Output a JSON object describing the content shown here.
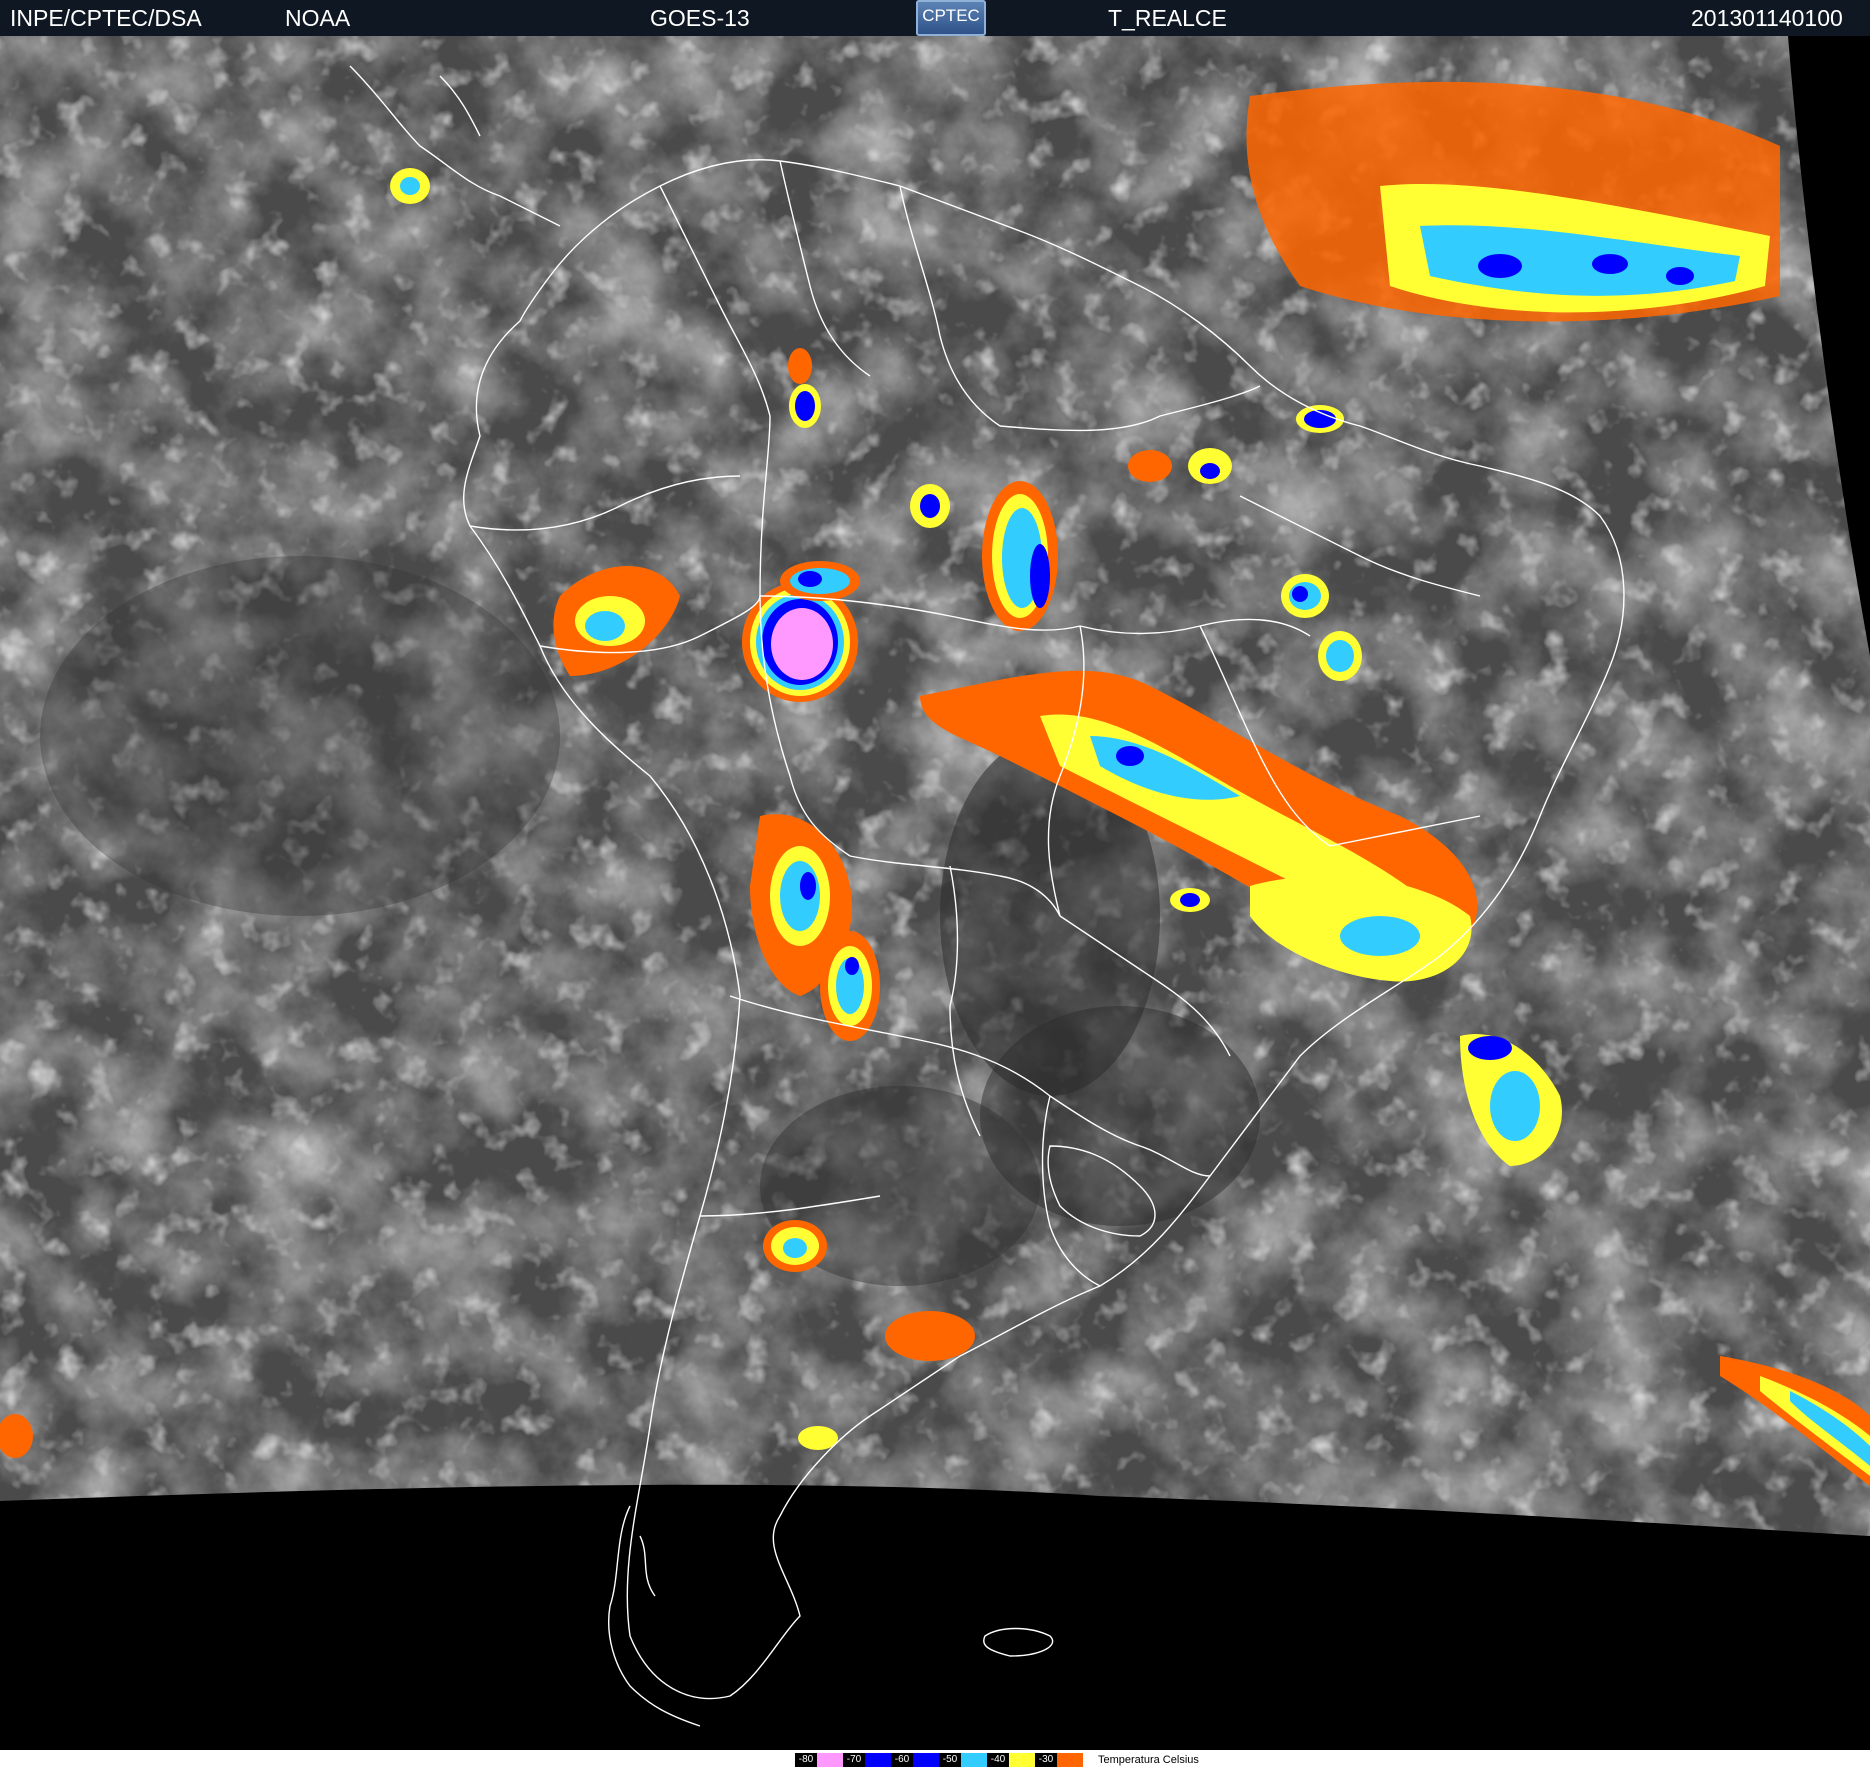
{
  "header": {
    "institution": "INPE/CPTEC/DSA",
    "agency": "NOAA",
    "satellite": "GOES-13",
    "logo_text": "CPTEC",
    "product": "T_REALCE",
    "timestamp": "201301140100"
  },
  "legend": {
    "title": "Temperatura   Celsius",
    "entries": [
      {
        "label": "-80",
        "color": "#ff99ff"
      },
      {
        "label": "-70",
        "color": "#0000ff"
      },
      {
        "label": "-60",
        "color": "#0000ff"
      },
      {
        "label": "-50",
        "color": "#33ccff"
      },
      {
        "label": "-40",
        "color": "#ffff33"
      },
      {
        "label": "-30",
        "color": "#ff6600"
      }
    ]
  },
  "map": {
    "region": "South America",
    "background_color": "#000000",
    "cloud_color": "#8a8a8a",
    "border_color": "#ffffff",
    "enhanced_colors": {
      "very_cold": "#ff99ff",
      "cold_blue": "#0000ff",
      "cyan": "#33ccff",
      "yellow": "#ffff33",
      "orange": "#ff6600"
    }
  }
}
